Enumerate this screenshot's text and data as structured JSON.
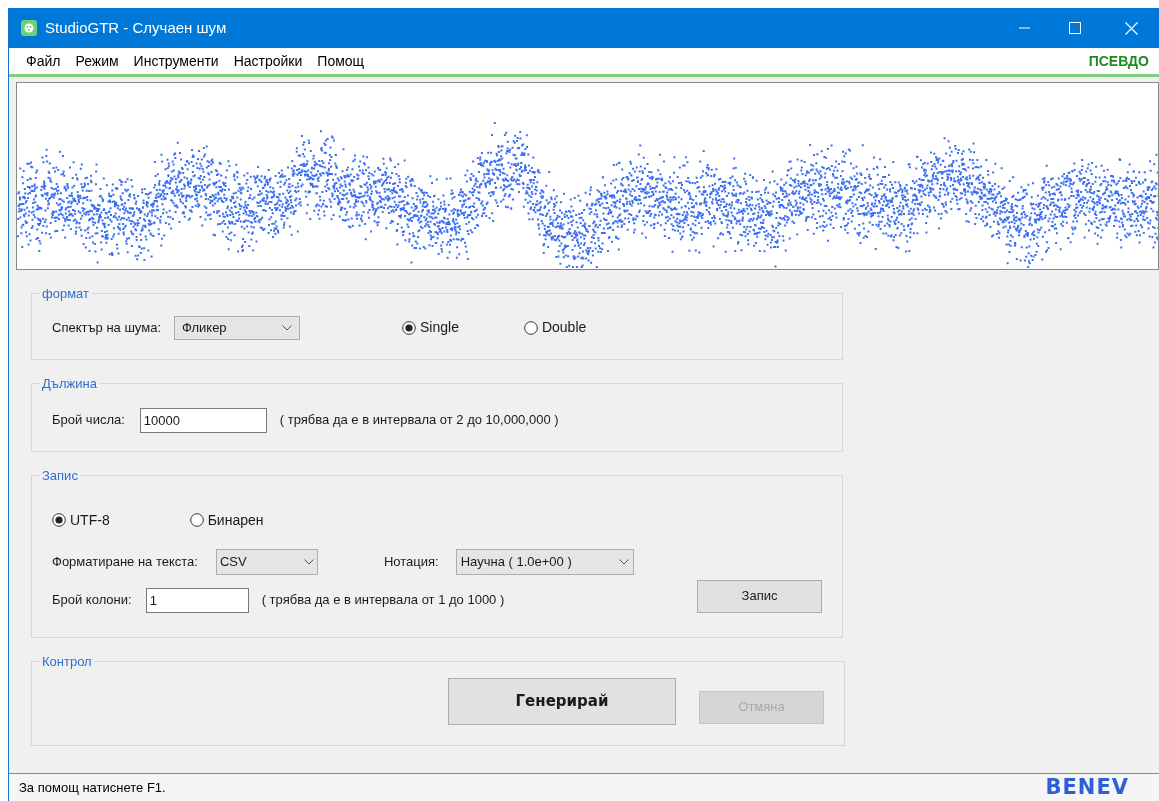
{
  "window": {
    "title": "StudioGTR - Случаен шум"
  },
  "menu": [
    "Файл",
    "Режим",
    "Инструменти",
    "Настройки",
    "Помощ"
  ],
  "mode_label": "ПСЕВДО",
  "format": {
    "legend": "формат",
    "spectrum_label": "Спектър на шума:",
    "spectrum_value": "Фликер",
    "precision": [
      {
        "label": "Single",
        "selected": true
      },
      {
        "label": "Double",
        "selected": false
      }
    ]
  },
  "length": {
    "legend": "Дължина",
    "count_label": "Брой числа:",
    "count_value": "10000",
    "hint": "( трябва да е в интервала от 2 до 10,000,000 )"
  },
  "write": {
    "legend": "Запис",
    "encoding": [
      {
        "label": "UTF-8",
        "selected": true
      },
      {
        "label": "Бинарен",
        "selected": false
      }
    ],
    "text_format_label": "Форматиране на текста:",
    "text_format_value": "CSV",
    "notation_label": "Нотация:",
    "notation_value": "Научна ( 1.0e+00 )",
    "columns_label": "Брой колони:",
    "columns_value": "1",
    "columns_hint": "( трябва да е в интервала от 1 до 1000 )",
    "save_button": "Запис"
  },
  "control": {
    "legend": "Контрол",
    "generate_button": "Генерирай",
    "cancel_button": {
      "label": "Отмяна",
      "disabled": true
    }
  },
  "status_bar": {
    "text": "За помощ натиснете F1.",
    "logo": "BENEV"
  }
}
